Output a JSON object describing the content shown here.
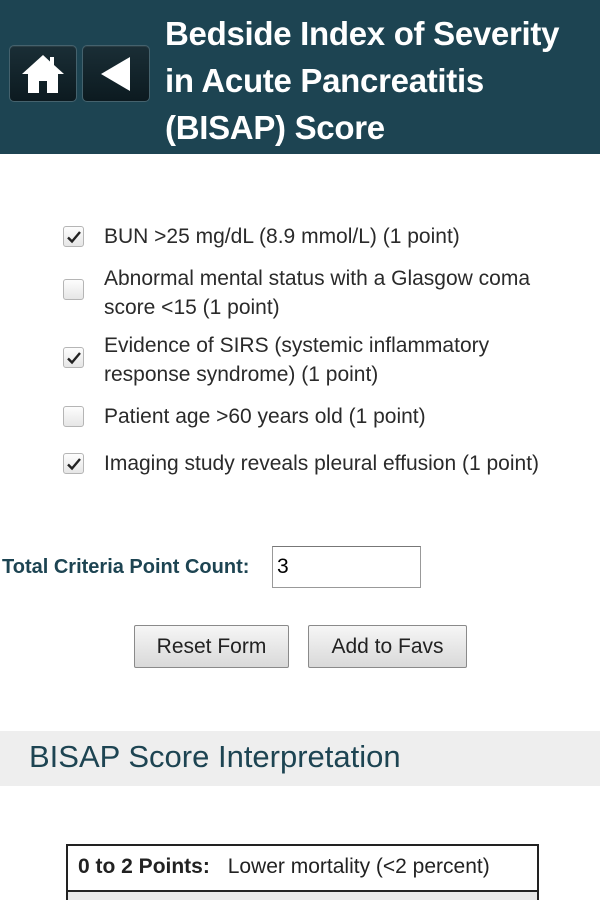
{
  "header": {
    "title_lines": [
      "Bedside Index of Severity",
      "in Acute Pancreatitis",
      "(BISAP) Score"
    ],
    "colors": {
      "background": "#1d4452",
      "title": "#ffffff"
    },
    "icons": {
      "home": "home-icon",
      "back": "back-arrow-icon"
    }
  },
  "criteria": [
    {
      "lines": [
        "BUN >25 mg/dL (8.9 mmol/L) (1 point)"
      ],
      "checked": true
    },
    {
      "lines": [
        "Abnormal mental status with a Glasgow coma",
        "score <15 (1 point)"
      ],
      "checked": false
    },
    {
      "lines": [
        "Evidence of SIRS (systemic inflammatory",
        "response syndrome) (1 point)"
      ],
      "checked": true
    },
    {
      "lines": [
        "Patient age >60 years old (1 point)"
      ],
      "checked": false
    },
    {
      "lines": [
        "Imaging study reveals pleural effusion (1 point)"
      ],
      "checked": true
    }
  ],
  "total": {
    "label": "Total Criteria Point Count:",
    "value": "3"
  },
  "buttons": {
    "reset_label": "Reset Form",
    "favs_label": "Add to Favs"
  },
  "interpretation": {
    "section_title": "BISAP Score Interpretation",
    "rows": [
      {
        "points": "0 to 2 Points:",
        "text": "Lower mortality (<2 percent)"
      }
    ]
  }
}
